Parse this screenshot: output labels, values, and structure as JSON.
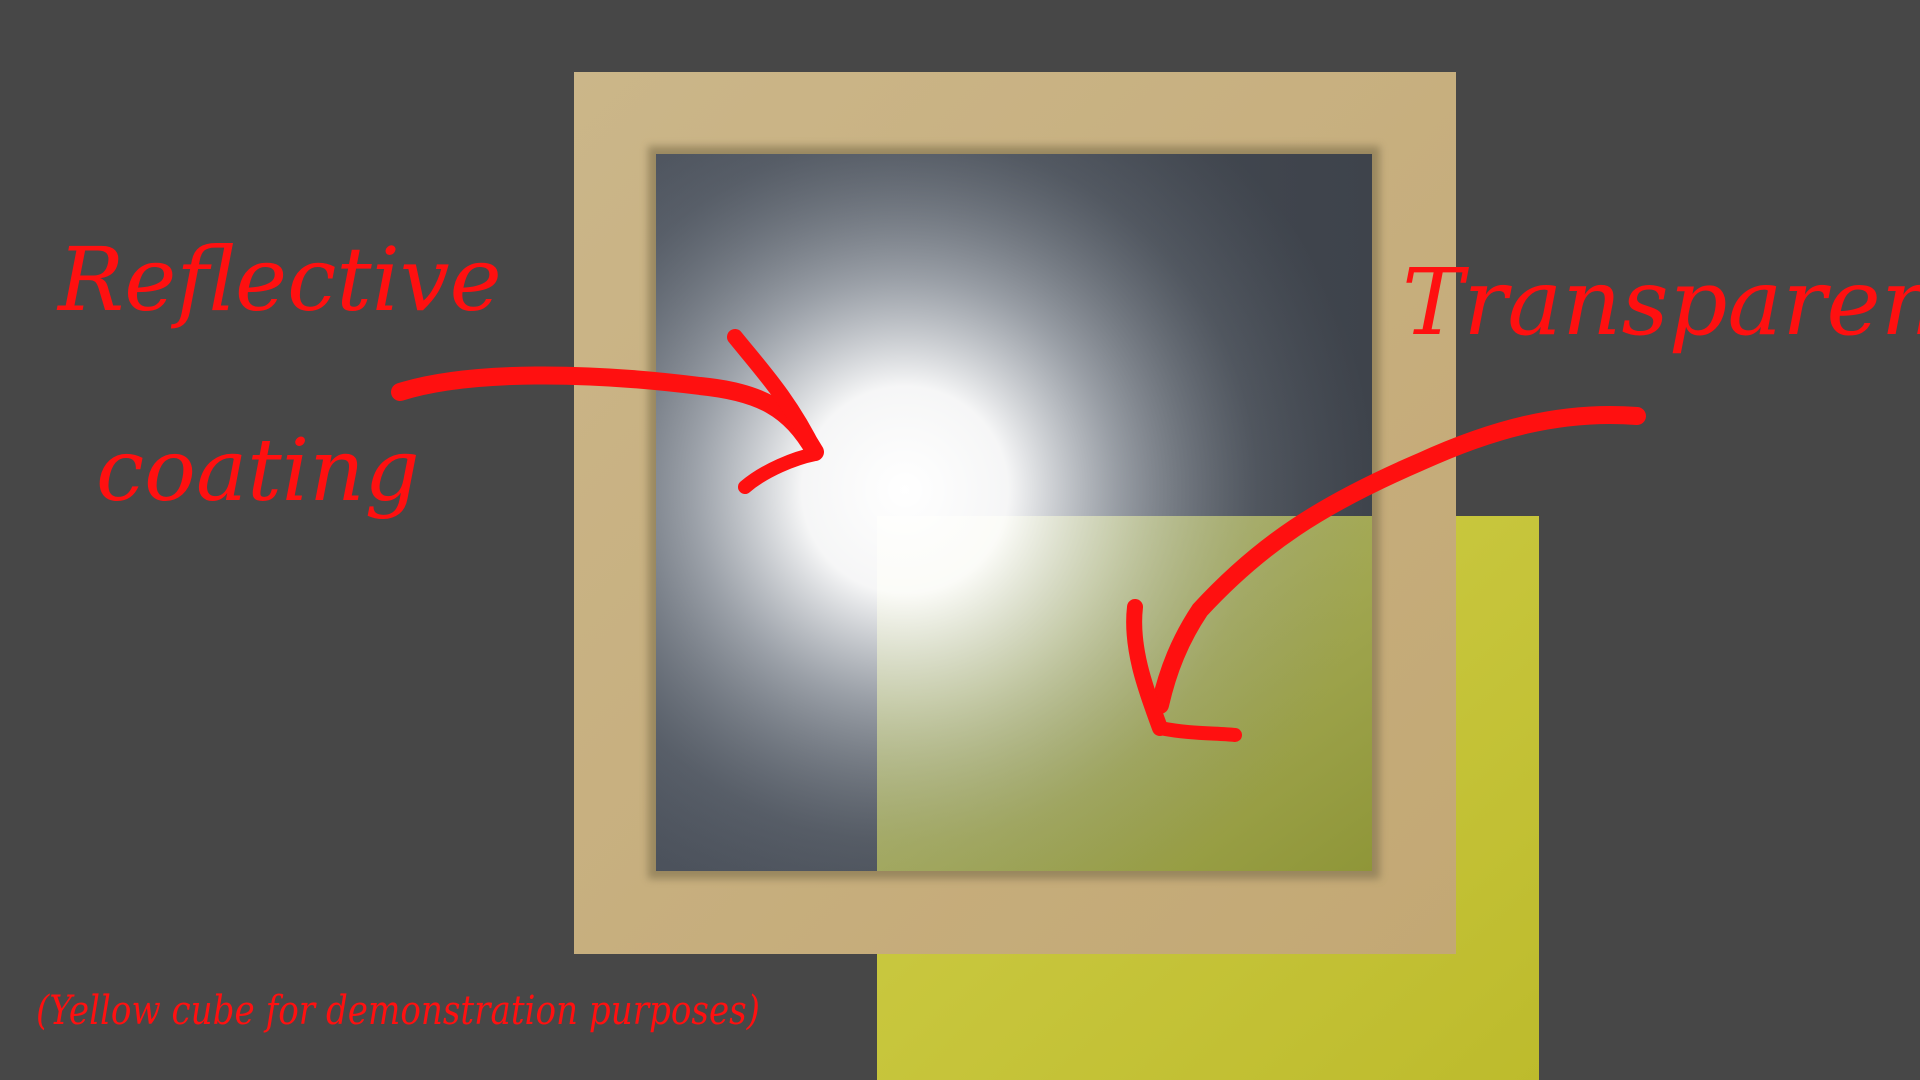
{
  "annotations": {
    "reflective_line1": "Reflective",
    "reflective_line2": "coating",
    "transparent": "Transparent",
    "footnote": "(Yellow cube for demonstration purposes)"
  },
  "colors": {
    "background": "#474747",
    "frame": "#c8b083",
    "frame_inner_shadow": "#8a7a55",
    "glass_dark": "#414750",
    "glass_highlight": "#ffffff",
    "cube": "#c6c43a",
    "cube_through_glass": "#9aa04a",
    "annotation": "#ff1010"
  },
  "icons": {
    "reflective_arrow": "curved-arrow-right",
    "transparent_arrow": "curved-arrow-down-left"
  }
}
